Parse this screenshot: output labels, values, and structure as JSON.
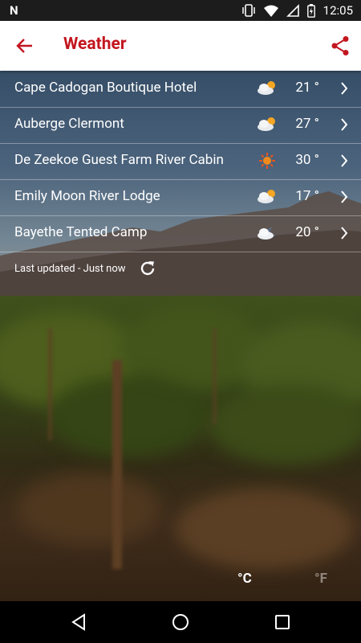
{
  "status_bar": {
    "time": "12:05",
    "icons": [
      "notification-n-icon",
      "vibrate-icon",
      "wifi-icon",
      "no-sim-icon",
      "battery-charging-icon"
    ]
  },
  "app_bar": {
    "title": "Weather",
    "back_icon": "arrow-left-icon",
    "share_icon": "share-icon",
    "accent_color": "#c3161f"
  },
  "locations": [
    {
      "name": "Cape Cadogan Boutique Hotel",
      "temp": "21 °",
      "icon": "partly-cloudy-icon"
    },
    {
      "name": "Auberge Clermont",
      "temp": "27 °",
      "icon": "partly-cloudy-icon"
    },
    {
      "name": "De Zeekoe Guest Farm River Cabin",
      "temp": "30 °",
      "icon": "sun-icon"
    },
    {
      "name": "Emily Moon River Lodge",
      "temp": "17 °",
      "icon": "partly-cloudy-icon"
    },
    {
      "name": "Bayethe Tented Camp",
      "temp": "20 °",
      "icon": "cloud-moon-icon"
    }
  ],
  "last_updated": "Last updated - Just now",
  "units": {
    "celsius": "°C",
    "fahrenheit": "°F",
    "selected": "celsius"
  },
  "nav_bar": [
    "back-triangle-icon",
    "home-circle-icon",
    "recents-square-icon"
  ]
}
